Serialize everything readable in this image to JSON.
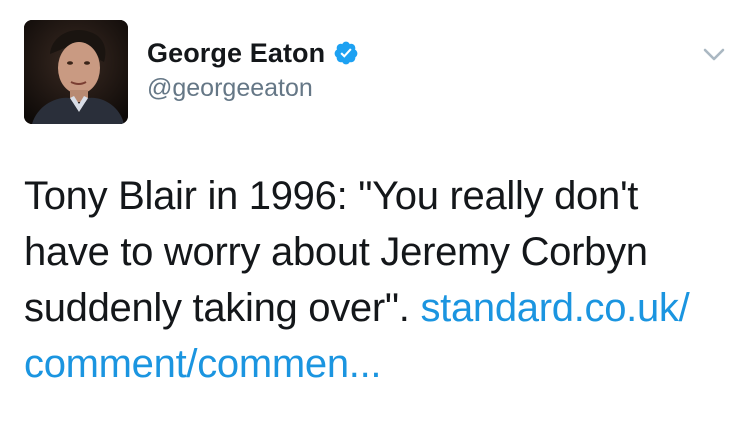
{
  "user": {
    "display_name": "George Eaton",
    "handle": "@georgeeaton",
    "verified": true
  },
  "tweet": {
    "text": "Tony Blair in 1996: \"You really don't have to worry about Jeremy Corbyn suddenly taking over\".",
    "link_text": "standard.co.uk/ comment/commen..."
  },
  "icons": {
    "verified": "verified-badge-icon",
    "caret": "chevron-down-icon"
  },
  "colors": {
    "link": "#1b95e0",
    "verified": "#1da1f2",
    "handle": "#657786",
    "text": "#14171a",
    "caret": "#aab8c2"
  }
}
